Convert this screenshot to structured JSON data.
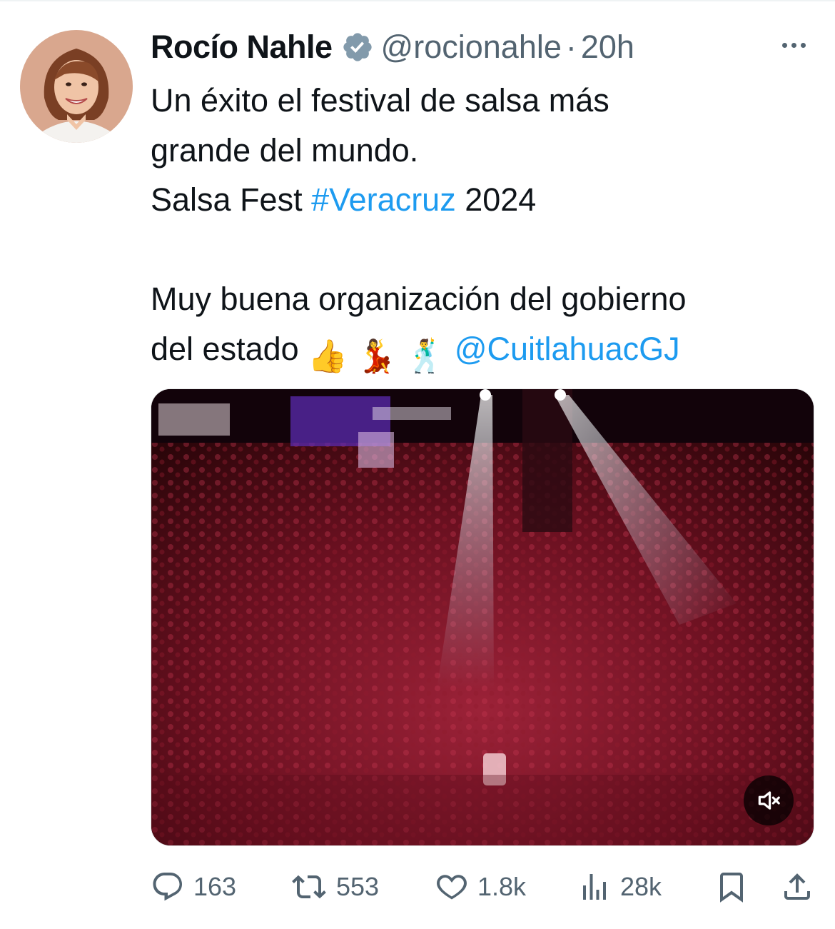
{
  "author": {
    "name": "Rocío Nahle",
    "handle": "@rocionahle",
    "separator": "·",
    "time": "20h",
    "verified_icon": "verified-badge-icon",
    "verified_color": "#829aab"
  },
  "tweet": {
    "line1": "Un éxito el festival de salsa más",
    "line2": "grande del mundo.",
    "line3_prefix": "Salsa Fest ",
    "hashtag": "#Veracruz",
    "line3_suffix": " 2024",
    "line4": "Muy buena organización del gobierno",
    "line5_prefix": "del estado ",
    "emojis": [
      "👍",
      "💃",
      "🕺"
    ],
    "mention": "@CuitlahuacGJ",
    "link_color": "#1d9bf0"
  },
  "media": {
    "type": "video",
    "mute_icon": "volume-muted-icon"
  },
  "actions": {
    "replies": "163",
    "reposts": "553",
    "likes": "1.8k",
    "views": "28k",
    "reply_icon": "reply-icon",
    "repost_icon": "repost-icon",
    "like_icon": "heart-icon",
    "views_icon": "analytics-icon",
    "bookmark_icon": "bookmark-icon",
    "share_icon": "share-icon",
    "icon_color": "#536471"
  }
}
